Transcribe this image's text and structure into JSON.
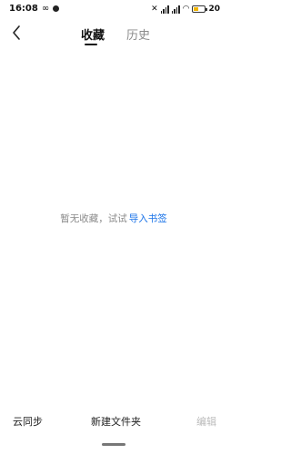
{
  "status_bar": {
    "time": "16:08",
    "battery_level": "20",
    "battery_color": "#f0b400"
  },
  "header": {
    "back_icon": "chevron-left-icon",
    "tabs": [
      {
        "label": "收藏",
        "active": true
      },
      {
        "label": "历史",
        "active": false
      }
    ]
  },
  "empty_state": {
    "text": "暂无收藏，试试",
    "link": "导入书签",
    "link_color": "#1a73e8"
  },
  "bottom_bar": {
    "sync_label": "云同步",
    "new_folder_label": "新建文件夹",
    "edit_label": "编辑"
  }
}
